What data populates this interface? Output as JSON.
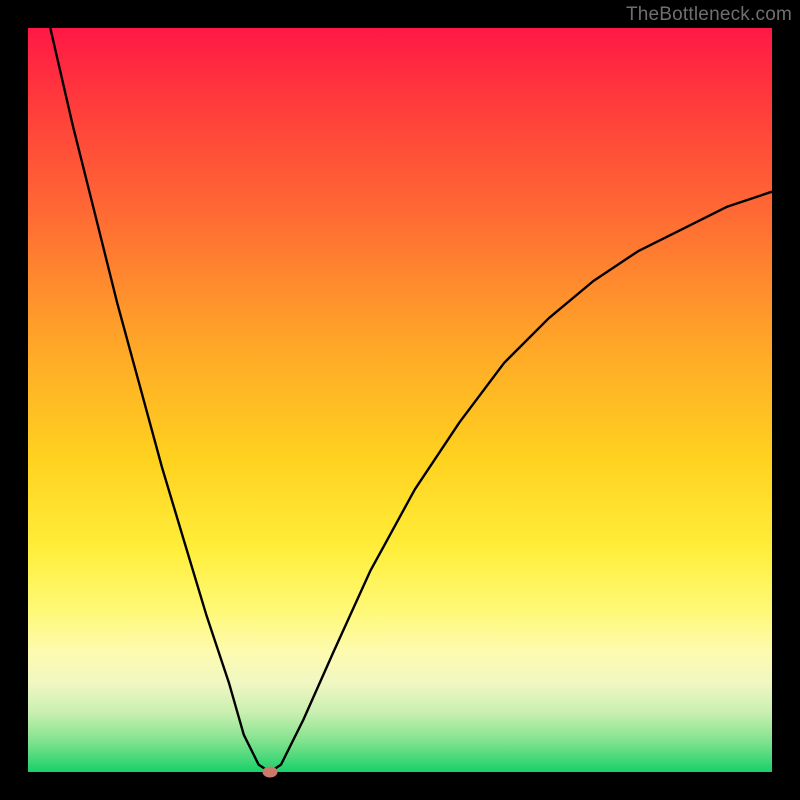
{
  "watermark": {
    "text": "TheBottleneck.com"
  },
  "colors": {
    "frame": "#000000",
    "curve": "#000000",
    "marker": "#c97a6a",
    "gradient_stops": [
      "#ff1846",
      "#ff3b3b",
      "#ff6a34",
      "#ffa528",
      "#ffd21f",
      "#ffee3a",
      "#fff974",
      "#fdfbb0",
      "#f0f7c2",
      "#c9f0b0",
      "#7ee28c",
      "#18d06a"
    ]
  },
  "chart_data": {
    "type": "line",
    "title": "",
    "xlabel": "",
    "ylabel": "",
    "xlim": [
      0,
      100
    ],
    "ylim": [
      0,
      100
    ],
    "grid": false,
    "legend": false,
    "series": [
      {
        "name": "bottleneck-curve",
        "x": [
          3,
          6,
          9,
          12,
          15,
          18,
          21,
          24,
          27,
          29,
          31,
          32.5,
          34,
          37,
          41,
          46,
          52,
          58,
          64,
          70,
          76,
          82,
          88,
          94,
          100
        ],
        "values": [
          100,
          87,
          75,
          63,
          52,
          41,
          31,
          21,
          12,
          5,
          1,
          0,
          1,
          7,
          16,
          27,
          38,
          47,
          55,
          61,
          66,
          70,
          73,
          76,
          78
        ]
      }
    ],
    "marker": {
      "x": 32.5,
      "y": 0,
      "label": "optimal-point"
    }
  }
}
